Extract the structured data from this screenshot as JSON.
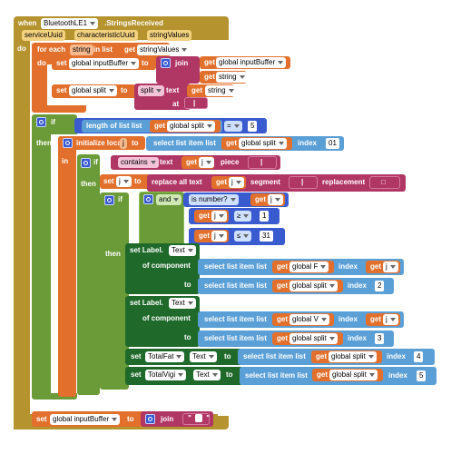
{
  "event": {
    "when": "when",
    "component": "BluetoothLE1",
    "event_name": ".StringsReceived",
    "params": [
      "serviceUuid",
      "characteristicUuid",
      "stringValues"
    ],
    "do": "do"
  },
  "foreach": {
    "label": "for each",
    "var": "string",
    "in_list": "in list",
    "get": "get",
    "list_var": "stringValues",
    "do": "do"
  },
  "set_input": {
    "set": "set",
    "var": "global inputBuffer",
    "to": "to",
    "join": "join",
    "get1": "get",
    "var1": "global inputBuffer",
    "get2": "get",
    "var2": "string"
  },
  "set_split": {
    "set": "set",
    "var": "global split",
    "to": "to",
    "op": "split",
    "text": "text",
    "get": "get",
    "var_text": "string",
    "at": "at",
    "at_value": "|"
  },
  "if1": {
    "if": "if",
    "length": "length of list  list",
    "get": "get",
    "var": "global split",
    "cmp": "=",
    "value": "5",
    "then": "then"
  },
  "local": {
    "label": "initialize local",
    "name": "j",
    "to": "to",
    "select": "select list item  list",
    "get": "get",
    "var": "global split",
    "index": "index",
    "index_value": "01",
    "in": "in"
  },
  "if2": {
    "if": "if",
    "contains": "contains",
    "text": "text",
    "get": "get",
    "var": "j",
    "piece": "piece",
    "piece_value": "|",
    "then": "then"
  },
  "replace": {
    "set": "set",
    "var": "j",
    "to": "to",
    "op": "replace all text",
    "get": "get",
    "var_text": "j",
    "segment": "segment",
    "segment_value": "|",
    "replacement": "replacement",
    "replacement_value": "□"
  },
  "if3": {
    "if": "if",
    "and": "and",
    "is_number": "is number?",
    "get1": "get",
    "var1": "j",
    "op1": "≥",
    "val1": "1",
    "get2": "get",
    "var2": "j",
    "op2": "≤",
    "val2": "31",
    "then": "then"
  },
  "label_f": {
    "set": "set Label.",
    "prop": "Text",
    "of_component": "of component",
    "to": "to",
    "select1": "select list item  list",
    "get1": "get",
    "var1": "global F",
    "index1": "index",
    "get_idx": "get",
    "idx_var": "j",
    "select2": "select list item  list",
    "get2": "get",
    "var2": "global split",
    "index2": "index",
    "idx2": "2"
  },
  "label_v": {
    "set": "set Label.",
    "prop": "Text",
    "of_component": "of component",
    "to": "to",
    "select1": "select list item  list",
    "get1": "get",
    "var1": "global V",
    "index1": "index",
    "get_idx": "get",
    "idx_var": "j",
    "select2": "select list item  list",
    "get2": "get",
    "var2": "global split",
    "index2": "index",
    "idx2": "3"
  },
  "total_fat": {
    "set": "set",
    "comp": "TotalFat",
    "prop": "Text",
    "to": "to",
    "select": "select list item  list",
    "get": "get",
    "var": "global split",
    "index": "index",
    "idx": "4"
  },
  "total_vigi": {
    "set": "set",
    "comp": "TotalVigi",
    "prop": "Text",
    "to": "to",
    "select": "select list item  list",
    "get": "get",
    "var": "global split",
    "index": "index",
    "idx": "5"
  },
  "reset": {
    "set": "set",
    "var": "global inputBuffer",
    "to": "to",
    "join": "join"
  },
  "colors": {
    "event": "#b5932e",
    "control": "#6b9b38",
    "variable": "#e2702c",
    "text": "#b03664",
    "list": "#5a9fd6",
    "math": "#3a5bd0",
    "component": "#1f6a2a"
  }
}
